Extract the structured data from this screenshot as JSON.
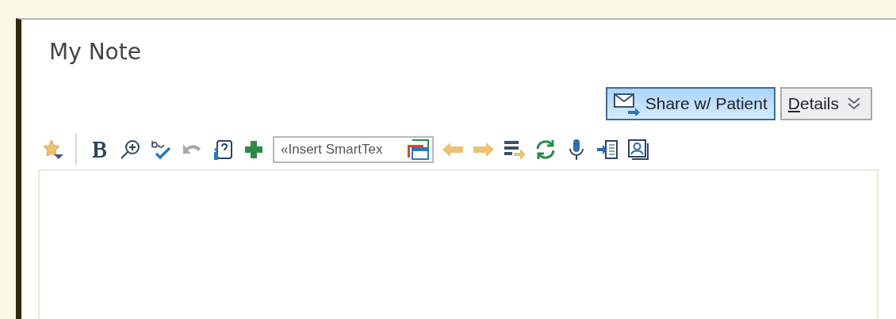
{
  "note": {
    "title": "My Note"
  },
  "actions": [
    {
      "kind": "share",
      "label": "Share w/ Patient",
      "selected": true
    },
    {
      "kind": "menu",
      "label": "Details",
      "selected": false
    }
  ],
  "toolbar": [
    {
      "kind": "icon"
    },
    {
      "kind": "separator"
    },
    {
      "kind": "icon"
    },
    {
      "kind": "icon"
    },
    {
      "kind": "icon"
    },
    {
      "kind": "icon",
      "disabled": true
    },
    {
      "kind": "icon"
    },
    {
      "kind": "icon"
    },
    {
      "kind": "field",
      "placeholder": "«Insert SmartTex"
    },
    {
      "kind": "icon"
    },
    {
      "kind": "icon"
    },
    {
      "kind": "icon"
    },
    {
      "kind": "icon"
    },
    {
      "kind": "icon"
    },
    {
      "kind": "icon"
    },
    {
      "kind": "icon"
    }
  ]
}
